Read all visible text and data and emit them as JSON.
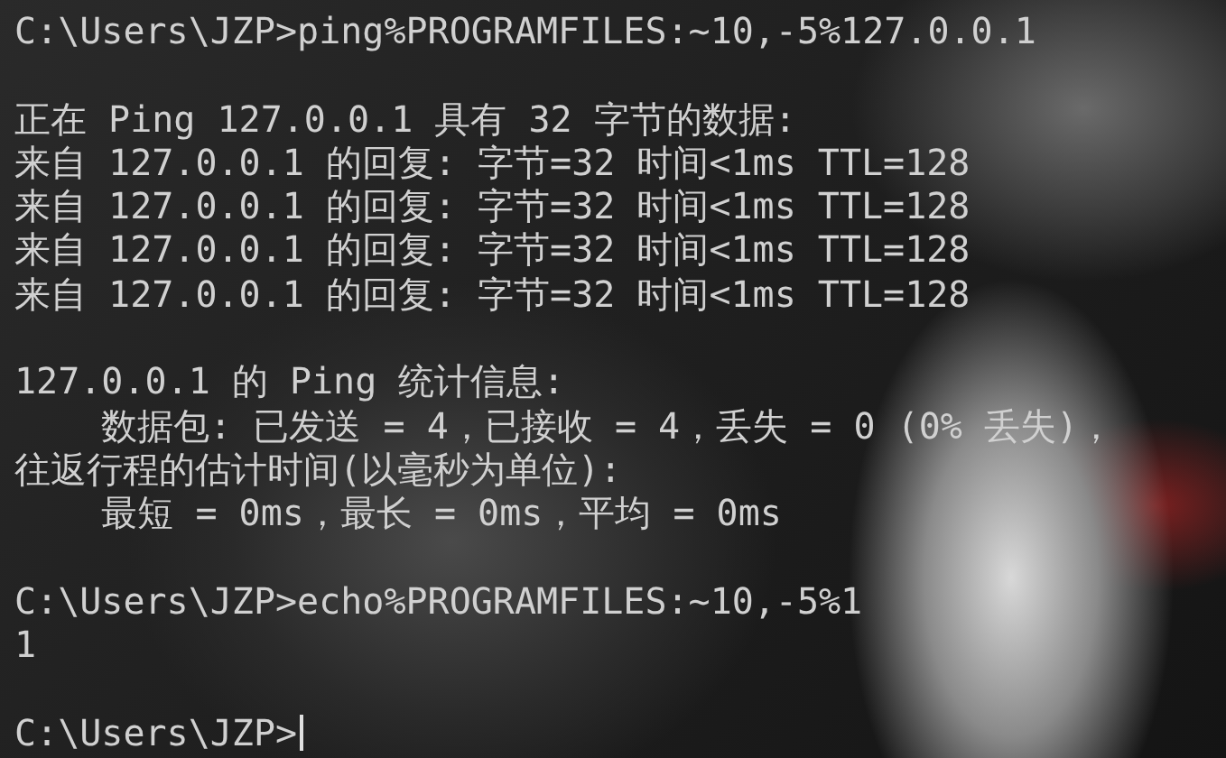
{
  "terminal": {
    "blocks": [
      [
        "C:\\Users\\JZP>ping%PROGRAMFILES:~10,-5%127.0.0.1"
      ],
      [
        "正在 Ping 127.0.0.1 具有 32 字节的数据:",
        "来自 127.0.0.1 的回复: 字节=32 时间<1ms TTL=128",
        "来自 127.0.0.1 的回复: 字节=32 时间<1ms TTL=128",
        "来自 127.0.0.1 的回复: 字节=32 时间<1ms TTL=128",
        "来自 127.0.0.1 的回复: 字节=32 时间<1ms TTL=128"
      ],
      [
        "127.0.0.1 的 Ping 统计信息:",
        "    数据包: 已发送 = 4，已接收 = 4，丢失 = 0 (0% 丢失)，",
        "往返行程的估计时间(以毫秒为单位):",
        "    最短 = 0ms，最长 = 0ms，平均 = 0ms"
      ],
      [
        "C:\\Users\\JZP>echo%PROGRAMFILES:~10,-5%1",
        "1"
      ]
    ],
    "prompt": {
      "text": "C:\\Users\\JZP>",
      "cursor": true
    }
  }
}
